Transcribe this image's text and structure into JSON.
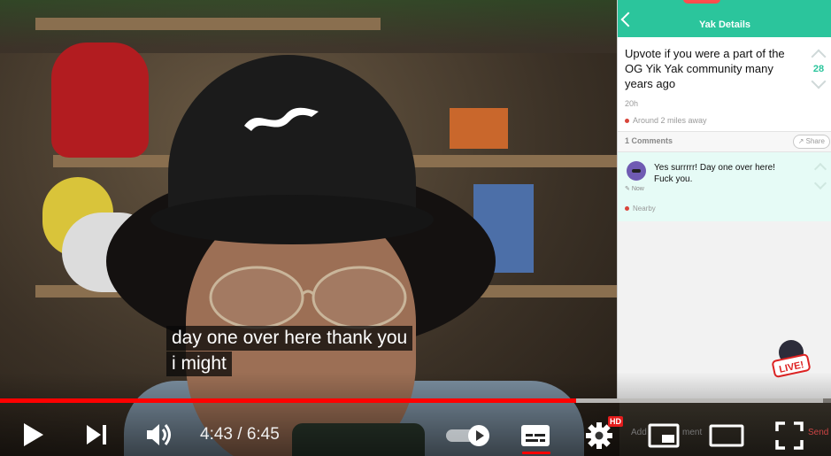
{
  "video": {
    "captions": [
      "day one over here thank you",
      "i might"
    ],
    "current_time": "4:43",
    "duration": "6:45",
    "time_separator": "/",
    "progress_fraction": 0.693,
    "buffered_fraction": 0.99,
    "hd_badge": "HD",
    "colors": {
      "progress": "#ff0000",
      "accent": "#2bc59c"
    }
  },
  "controls": {
    "play": "play-icon",
    "next": "next-icon",
    "volume": "volume-icon",
    "autoplay": "autoplay-toggle",
    "subtitles": "subtitles-icon",
    "settings": "gear-icon",
    "miniplayer": "miniplayer-icon",
    "theater": "theater-icon",
    "fullscreen": "fullscreen-icon",
    "faded_text_left": "Add",
    "faded_text_mid": "ment",
    "faded_text_right": "Send"
  },
  "phone": {
    "header_title": "Yak Details",
    "post": {
      "text": "Upvote if you were a part of the OG Yik Yak community many years ago",
      "votes": "28",
      "time": "20h",
      "location": "Around 2 miles away"
    },
    "comments_label": "1 Comments",
    "share_label": "Share",
    "comment": {
      "text": "Yes surrrrr! Day one over here! Fuck you.",
      "time": "Now",
      "location": "Nearby"
    },
    "sticker_text": "LIVE!"
  }
}
